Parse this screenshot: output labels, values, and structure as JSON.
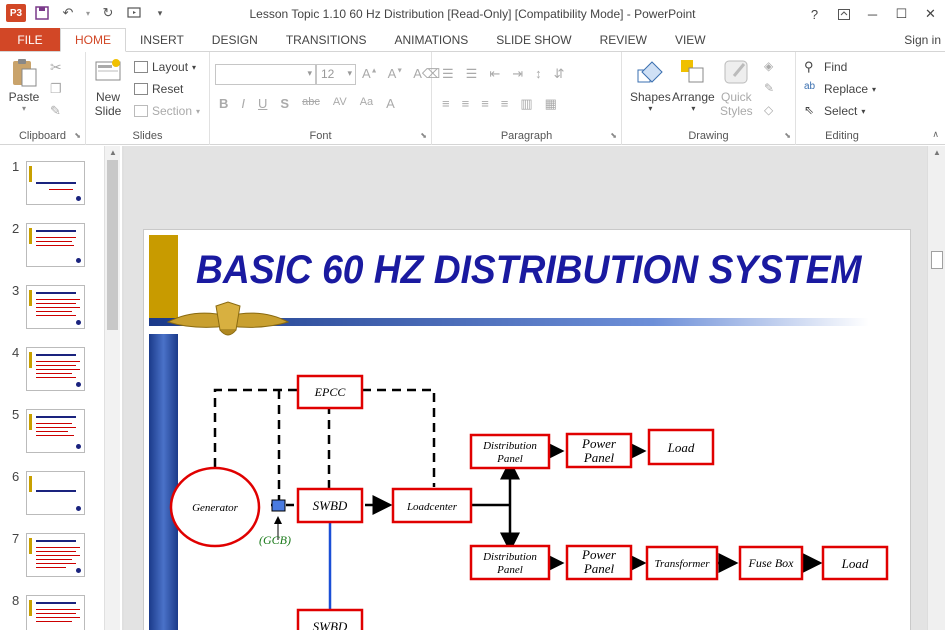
{
  "titlebar": {
    "title": "Lesson Topic 1.10 60 Hz Distribution [Read-Only] [Compatibility Mode] - PowerPoint",
    "app_badge": "P3",
    "help": "?"
  },
  "tabs": [
    "FILE",
    "HOME",
    "INSERT",
    "DESIGN",
    "TRANSITIONS",
    "ANIMATIONS",
    "SLIDE SHOW",
    "REVIEW",
    "VIEW"
  ],
  "active_tab": "HOME",
  "signin": "Sign in",
  "ribbon": {
    "clipboard": {
      "paste": "Paste",
      "label": "Clipboard"
    },
    "slides": {
      "new_slide_1": "New",
      "new_slide_2": "Slide",
      "layout": "Layout",
      "reset": "Reset",
      "section": "Section",
      "label": "Slides"
    },
    "font": {
      "family": "",
      "size": "12",
      "label": "Font"
    },
    "paragraph": {
      "label": "Paragraph"
    },
    "drawing": {
      "shapes": "Shapes",
      "arrange": "Arrange",
      "quick_1": "Quick",
      "quick_2": "Styles",
      "label": "Drawing"
    },
    "editing": {
      "find": "Find",
      "replace": "Replace",
      "select": "Select",
      "label": "Editing"
    }
  },
  "thumbnails": [
    "1",
    "2",
    "3",
    "4",
    "5",
    "6",
    "7",
    "8"
  ],
  "slide": {
    "title": "BASIC 60 HZ DISTRIBUTION SYSTEM",
    "nodes": {
      "epcc": "EPCC",
      "generator": "Generator",
      "gcb": "(GCB)",
      "swbd": "SWBD",
      "swbd2": "SWBD",
      "loadcenter": "Loadcenter",
      "dist1_a": "Distribution",
      "dist1_b": "Panel",
      "dist2_a": "Distribution",
      "dist2_b": "Panel",
      "power1_a": "Power",
      "power1_b": "Panel",
      "power2_a": "Power",
      "power2_b": "Panel",
      "load1": "Load",
      "transformer": "Transformer",
      "fusebox": "Fuse Box",
      "load2": "Load"
    }
  },
  "colors": {
    "accent": "#d24726",
    "title_blue": "#1a1aa0",
    "box_red": "#e00000",
    "gold": "#c8a000"
  }
}
